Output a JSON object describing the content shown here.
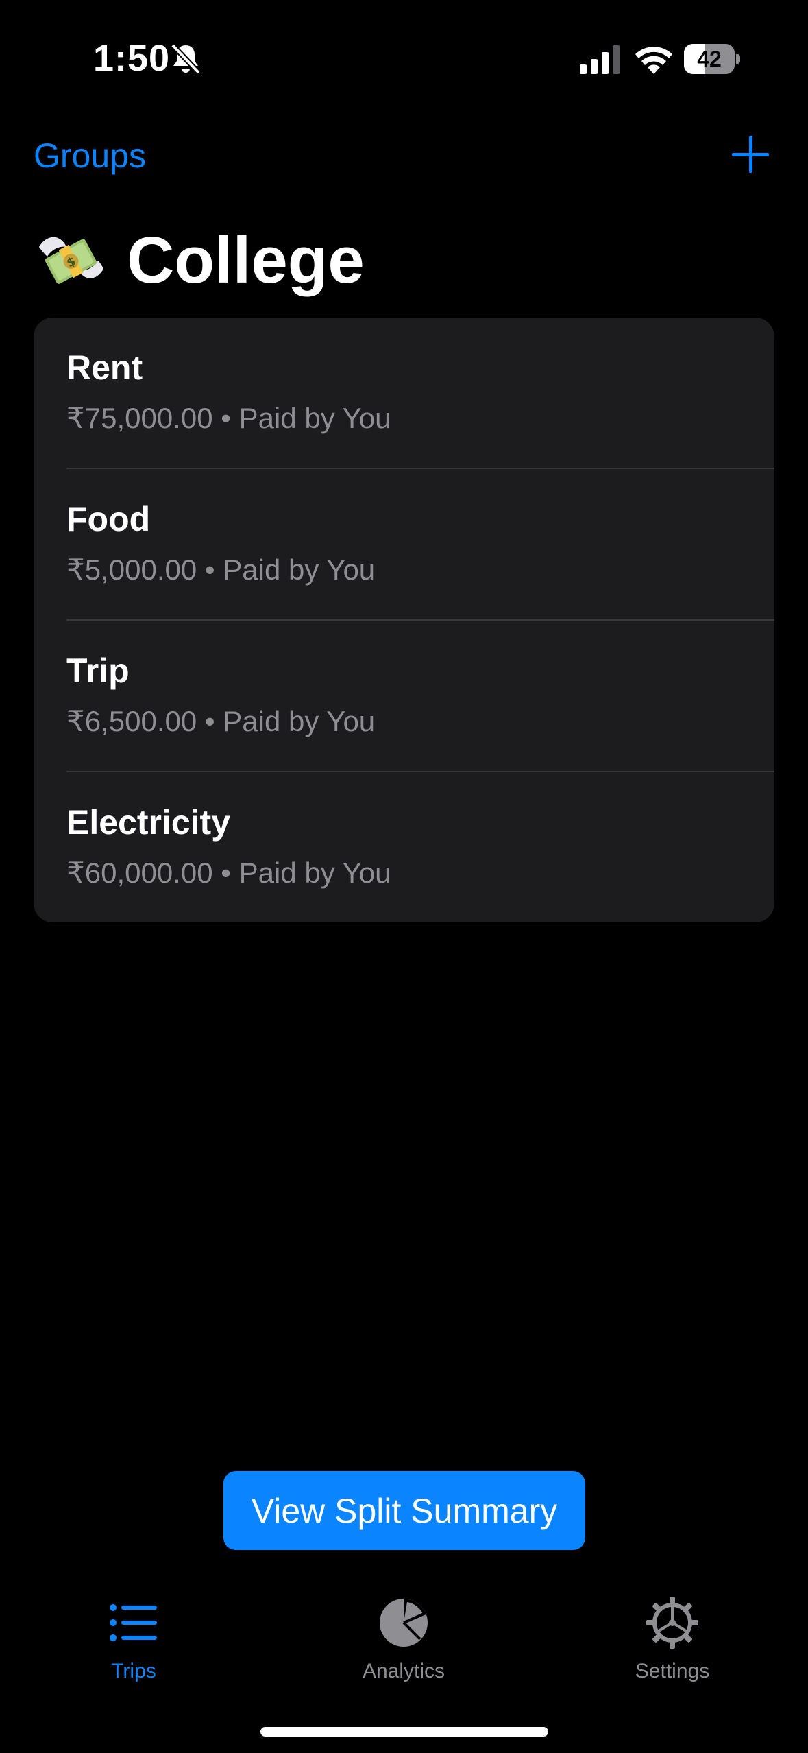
{
  "status_bar": {
    "time": "1:50",
    "battery": "42",
    "battery_level": 0.42
  },
  "nav": {
    "back_label": "Groups"
  },
  "title": {
    "text": "College"
  },
  "expenses": [
    {
      "title": "Rent",
      "amount": "₹75,000.00",
      "payer": "Paid by You"
    },
    {
      "title": "Food",
      "amount": "₹5,000.00",
      "payer": "Paid by You"
    },
    {
      "title": "Trip",
      "amount": "₹6,500.00",
      "payer": "Paid by You"
    },
    {
      "title": "Electricity",
      "amount": "₹60,000.00",
      "payer": "Paid by You"
    }
  ],
  "separator": "•",
  "cta": {
    "label": "View Split Summary"
  },
  "tabs": [
    {
      "label": "Trips",
      "icon": "list-icon",
      "active": true
    },
    {
      "label": "Analytics",
      "icon": "pie-chart-icon",
      "active": false
    },
    {
      "label": "Settings",
      "icon": "gear-icon",
      "active": false
    }
  ],
  "colors": {
    "accent": "#0a84ff",
    "background": "#000000",
    "card": "#1c1c1e",
    "secondary_text": "#8e8e93"
  }
}
